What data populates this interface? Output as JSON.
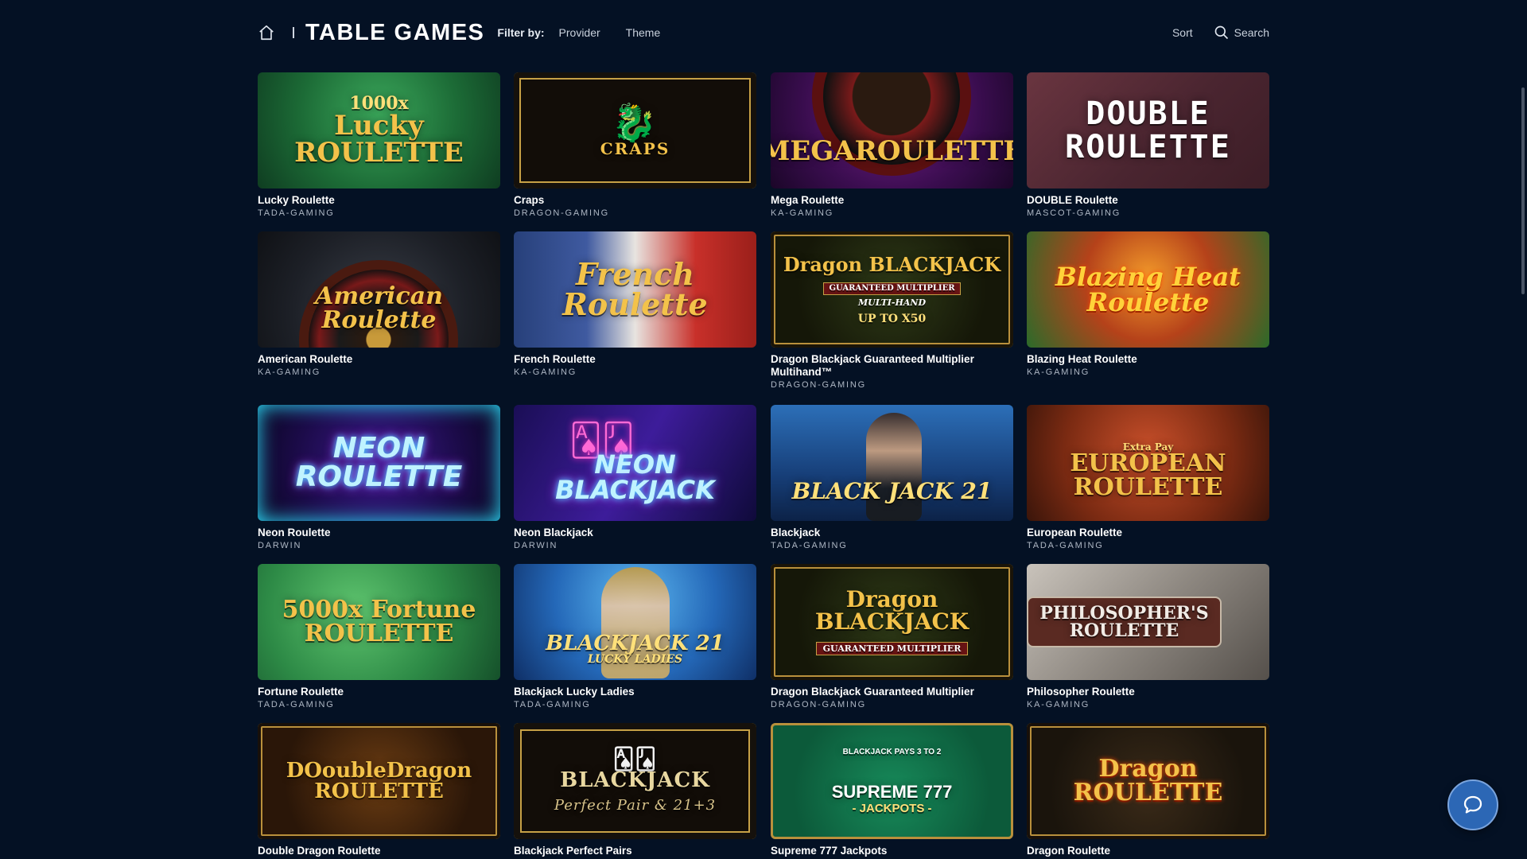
{
  "header": {
    "title": "TABLE GAMES",
    "filter_label": "Filter by:",
    "filter_provider": "Provider",
    "filter_theme": "Theme",
    "sort_label": "Sort",
    "search_label": "Search"
  },
  "games": [
    {
      "name": "Lucky Roulette",
      "provider": "TADA-GAMING",
      "art": "Lucky ROULETTE",
      "badge": "1000x"
    },
    {
      "name": "Craps",
      "provider": "DRAGON-GAMING",
      "art": "CRAPS"
    },
    {
      "name": "Mega Roulette",
      "provider": "KA-GAMING",
      "art": "MEGAROULETTE"
    },
    {
      "name": "DOUBLE Roulette",
      "provider": "MASCOT-GAMING",
      "art": "DOUBLE ROULETTE"
    },
    {
      "name": "American Roulette",
      "provider": "KA-GAMING",
      "art": "American Roulette"
    },
    {
      "name": "French Roulette",
      "provider": "KA-GAMING",
      "art": "French Roulette"
    },
    {
      "name": "Dragon Blackjack Guaranteed Multiplier Multihand™",
      "provider": "DRAGON-GAMING",
      "art": "Dragon BLACKJACK",
      "art_sub": "GUARANTEED MULTIPLIER",
      "art_sub2": "MULTI-HAND",
      "art_sub3": "UP TO X50"
    },
    {
      "name": "Blazing Heat Roulette",
      "provider": "KA-GAMING",
      "art": "Blazing Heat Roulette"
    },
    {
      "name": "Neon Roulette",
      "provider": "DARWIN",
      "art": "NEON ROULETTE"
    },
    {
      "name": "Neon Blackjack",
      "provider": "DARWIN",
      "art": "NEON BLACKJACK"
    },
    {
      "name": "Blackjack",
      "provider": "TADA-GAMING",
      "art": "BLACK JACK 21"
    },
    {
      "name": "European Roulette",
      "provider": "TADA-GAMING",
      "art": "EUROPEAN ROULETTE",
      "art_sub": "Extra Pay"
    },
    {
      "name": "Fortune Roulette",
      "provider": "TADA-GAMING",
      "art": "5000x Fortune ROULETTE"
    },
    {
      "name": "Blackjack Lucky Ladies",
      "provider": "TADA-GAMING",
      "art": "BLACKJACK 21",
      "art_sub": "LUCKY LADIES"
    },
    {
      "name": "Dragon Blackjack Guaranteed Multiplier",
      "provider": "DRAGON-GAMING",
      "art": "Dragon BLACKJACK",
      "art_sub": "GUARANTEED MULTIPLIER"
    },
    {
      "name": "Philosopher Roulette",
      "provider": "KA-GAMING",
      "art": "PHILOSOPHER'S ROULETTE"
    },
    {
      "name": "Double Dragon Roulette",
      "provider": "",
      "art": "DOoubleDragon ROULETTE"
    },
    {
      "name": "Blackjack Perfect Pairs",
      "provider": "",
      "art": "BLACKJACK",
      "art_sub": "Perfect Pair & 21+3"
    },
    {
      "name": "Supreme 777 Jackpots",
      "provider": "",
      "art": "SUPREME 777",
      "art_sub": "- JACKPOTS -",
      "art_top": "BLACKJACK PAYS 3 TO 2"
    },
    {
      "name": "Dragon Roulette",
      "provider": "",
      "art": "Dragon ROULETTE"
    }
  ],
  "icons": {
    "home": "home-icon",
    "search": "search-icon",
    "chat": "chat-icon"
  },
  "colors": {
    "background": "#041124",
    "accent_gold": "#f3c24a",
    "chat_button": "#2c67b5"
  }
}
